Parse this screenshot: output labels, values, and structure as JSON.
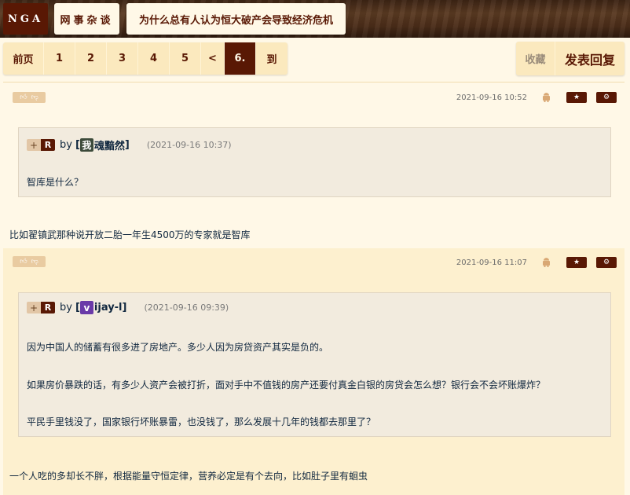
{
  "header": {
    "logo": "NGA",
    "breadcrumb": [
      "网事杂谈",
      "为什么总有人认为恒大破产会导致经济危机"
    ]
  },
  "pager": {
    "items": [
      "前页",
      "1",
      "2",
      "3",
      "4",
      "5",
      "<",
      "6.",
      "到"
    ],
    "current": "6."
  },
  "tools": {
    "favorite": "收藏",
    "reply": "发表回复"
  },
  "icons": {
    "vote": [
      "thumbs-up-icon",
      "thumbs-down-icon"
    ],
    "device": "android-icon",
    "star": "star-icon",
    "settings": "gear-icon"
  },
  "colors": {
    "accent": "#591804",
    "bg_light": "#fff8e7",
    "bg_alt": "#fdf0cf"
  },
  "posts": [
    {
      "date": "2021-09-16 10:52",
      "quote": {
        "by": "by",
        "user_avatar": "我",
        "user_name": "魂黯然",
        "bracket_open": "[",
        "bracket_close": "]",
        "date": "(2021-09-16 10:37)",
        "lines": [
          "智库是什么？"
        ]
      },
      "body": "比如翟镇武那种说开放二胎一年生4500万的专家就是智库"
    },
    {
      "date": "2021-09-16 11:07",
      "quote": {
        "by": "by",
        "user_avatar": "v",
        "user_name": "ijay-l",
        "bracket_open": "[",
        "bracket_close": "]",
        "date": "(2021-09-16 09:39)",
        "lines": [
          "因为中国人的储蓄有很多进了房地产。多少人因为房贷资产其实是负的。",
          "如果房价暴跌的话，有多少人资产会被打折，面对手中不值钱的房产还要付真金白银的房贷会怎么想？银行会不会坏账爆炸？",
          "平民手里钱没了，国家银行坏账暴雷，也没钱了，那么发展十几年的钱都去那里了？"
        ]
      },
      "body": "一个人吃的多却长不胖，根据能量守恒定律，营养必定是有个去向，比如肚子里有蛔虫"
    }
  ]
}
